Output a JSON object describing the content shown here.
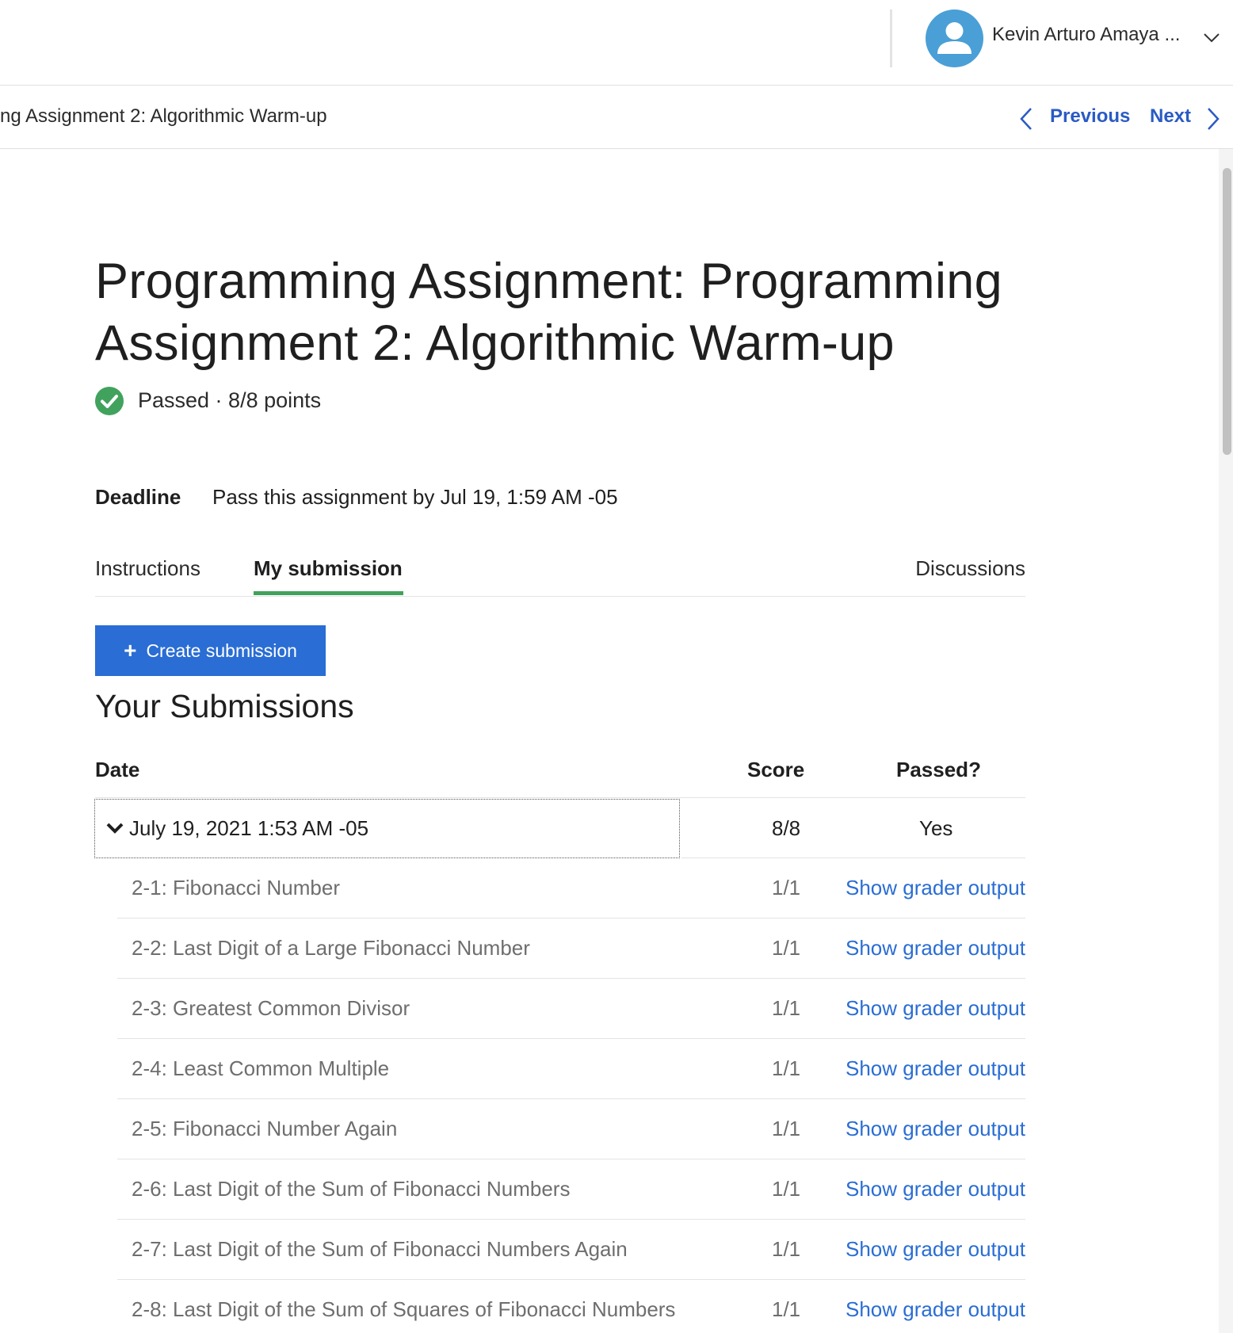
{
  "header": {
    "user_name": "Kevin Arturo Amaya ..."
  },
  "subnav": {
    "breadcrumb": "ng Assignment 2: Algorithmic Warm-up",
    "previous_label": "Previous",
    "next_label": "Next"
  },
  "assignment": {
    "title": "Programming Assignment: Programming Assignment 2: Algorithmic Warm-up",
    "status": "Passed · 8/8 points",
    "deadline_label": "Deadline",
    "deadline_text": "Pass this assignment by Jul 19, 1:59 AM -05"
  },
  "tabs": {
    "instructions": "Instructions",
    "my_submission": "My submission",
    "discussions": "Discussions"
  },
  "create_button_label": "Create submission",
  "submissions": {
    "title": "Your Submissions",
    "columns": {
      "date": "Date",
      "score": "Score",
      "passed": "Passed?"
    },
    "entry": {
      "date": "July 19, 2021 1:53 AM -05",
      "score": "8/8",
      "passed": "Yes"
    },
    "parts": [
      {
        "name": "2-1: Fibonacci Number",
        "score": "1/1",
        "link": "Show grader output"
      },
      {
        "name": "2-2: Last Digit of a Large Fibonacci Number",
        "score": "1/1",
        "link": "Show grader output"
      },
      {
        "name": "2-3: Greatest Common Divisor",
        "score": "1/1",
        "link": "Show grader output"
      },
      {
        "name": "2-4: Least Common Multiple",
        "score": "1/1",
        "link": "Show grader output"
      },
      {
        "name": "2-5: Fibonacci Number Again",
        "score": "1/1",
        "link": "Show grader output"
      },
      {
        "name": "2-6: Last Digit of the Sum of Fibonacci Numbers",
        "score": "1/1",
        "link": "Show grader output"
      },
      {
        "name": "2-7: Last Digit of the Sum of Fibonacci Numbers Again",
        "score": "1/1",
        "link": "Show grader output"
      },
      {
        "name": "2-8: Last Digit of the Sum of Squares of Fibonacci Numbers",
        "score": "1/1",
        "link": "Show grader output"
      }
    ]
  },
  "colors": {
    "accent_blue": "#2a6dd4",
    "nav_blue": "#2a5bc4",
    "success_green": "#41a25d",
    "avatar_blue": "#4a9fd6"
  },
  "icons": {
    "avatar": "user-avatar-icon",
    "user_menu": "chevron-down-icon",
    "previous": "chevron-left-icon",
    "next": "chevron-right-icon",
    "status": "check-circle-icon",
    "create": "plus-icon",
    "expand": "chevron-down-icon"
  }
}
